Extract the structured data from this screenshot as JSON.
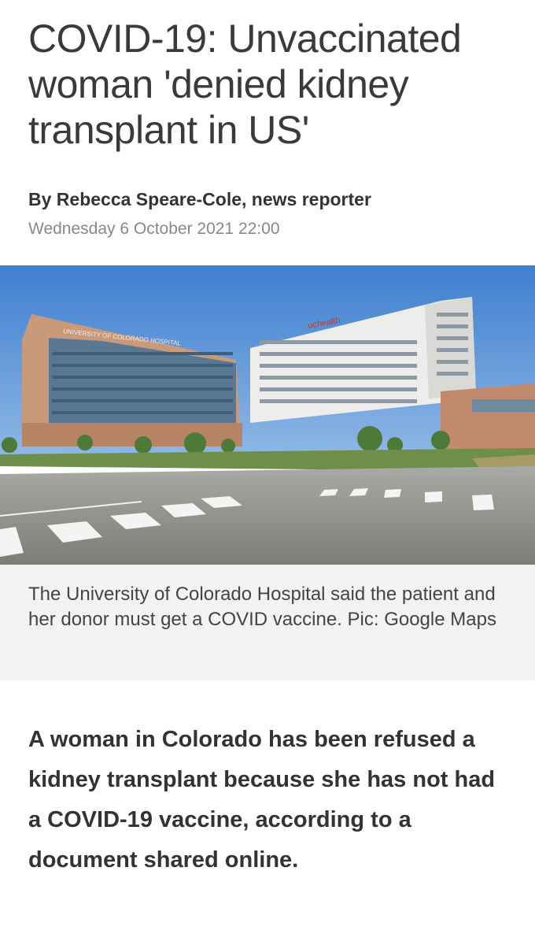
{
  "article": {
    "headline": "COVID-19: Unvaccinated woman 'denied kidney transplant in US'",
    "byline": "By Rebecca Speare-Cole, news reporter",
    "date": "Wednesday 6 October 2021 22:00",
    "image": {
      "sign_text": "uchealth",
      "building_sign": "UNIVERSITY OF COLORADO HOSPITAL"
    },
    "caption": "The University of Colorado Hospital said the patient and her donor must get a COVID vaccine. Pic: Google Maps",
    "lead": "A woman in Colorado has been refused a kidney transplant because she has not had a COVID-19 vaccine, according to a document shared online."
  }
}
